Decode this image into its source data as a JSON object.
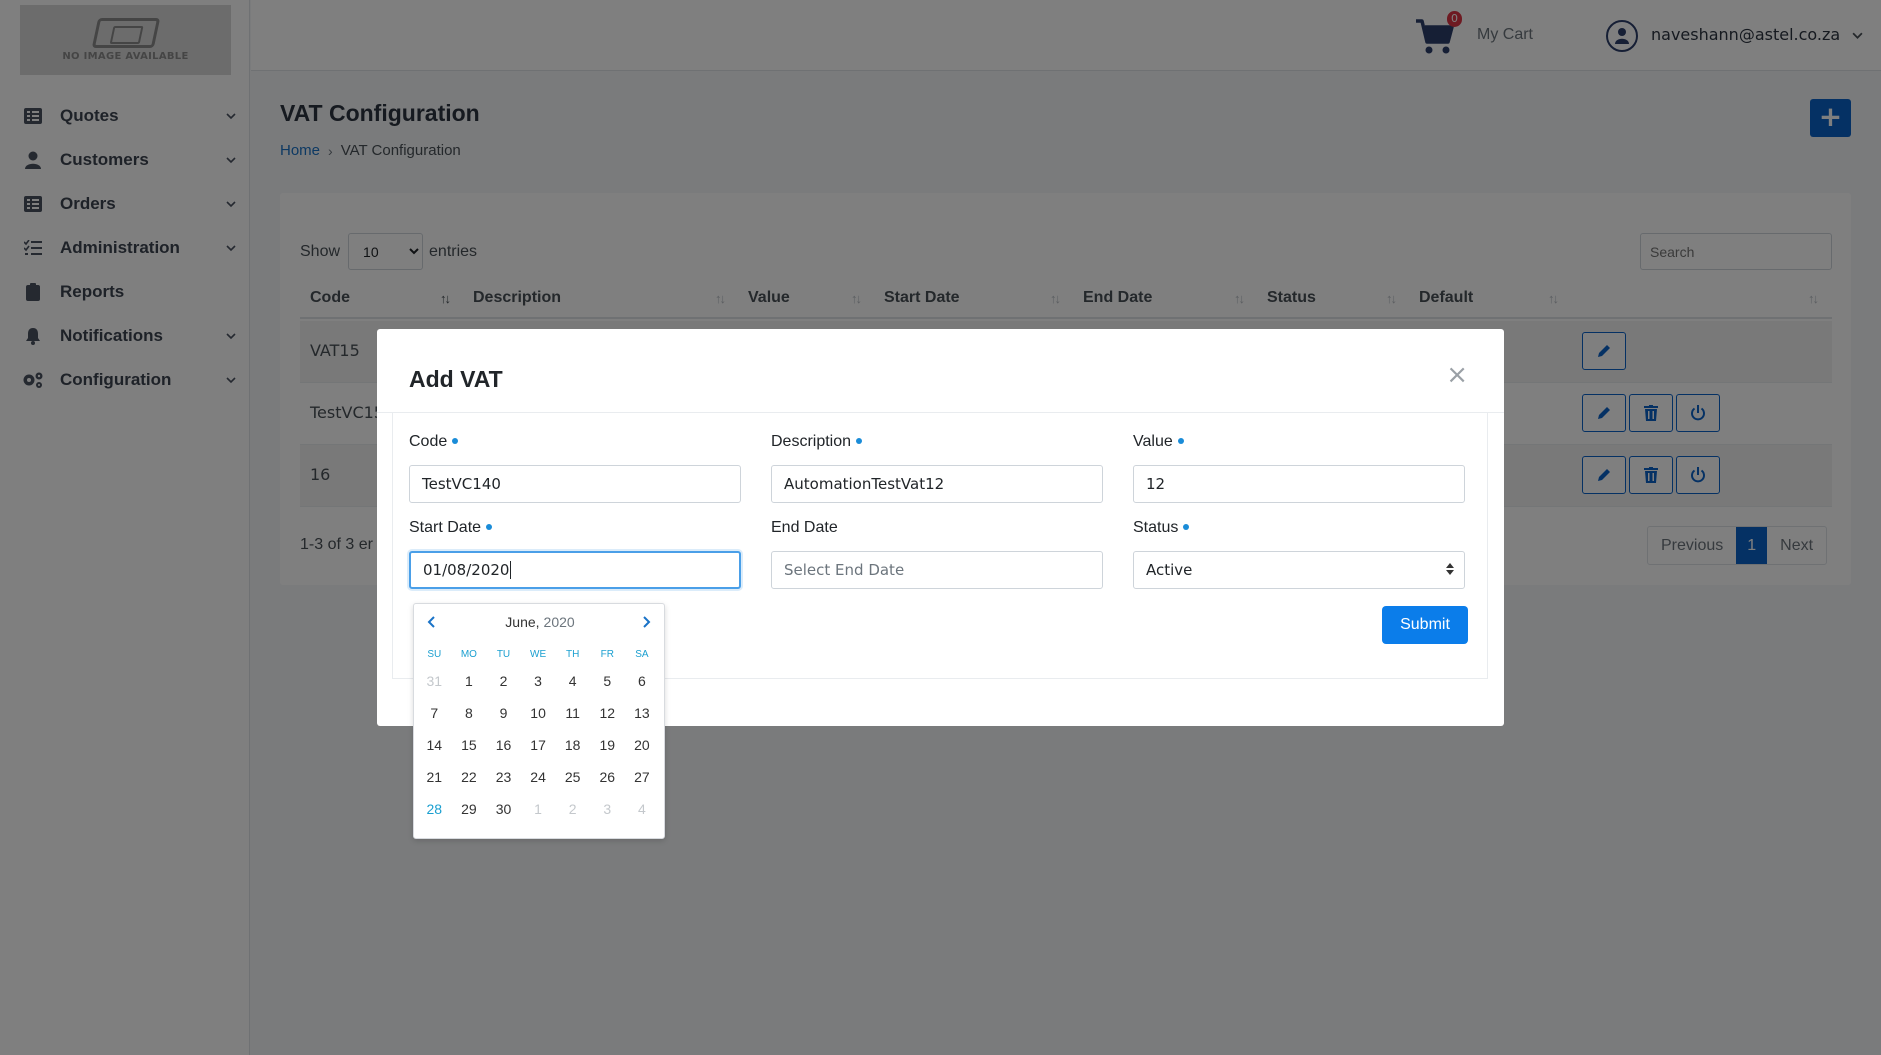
{
  "sidebar": {
    "logo_text": "NO IMAGE AVAILABLE",
    "items": [
      {
        "label": "Quotes",
        "icon": "list-icon",
        "has_chevron": true
      },
      {
        "label": "Customers",
        "icon": "user-icon",
        "has_chevron": true
      },
      {
        "label": "Orders",
        "icon": "list-icon",
        "has_chevron": true
      },
      {
        "label": "Administration",
        "icon": "tasks-icon",
        "has_chevron": true
      },
      {
        "label": "Reports",
        "icon": "clipboard-icon",
        "has_chevron": false
      },
      {
        "label": "Notifications",
        "icon": "bell-icon",
        "has_chevron": true
      },
      {
        "label": "Configuration",
        "icon": "cogs-icon",
        "has_chevron": true
      }
    ]
  },
  "topbar": {
    "cart_count": "0",
    "cart_label": "My Cart",
    "user_email": "naveshann@astel.co.za"
  },
  "page": {
    "title": "VAT Configuration",
    "breadcrumb_home": "Home",
    "breadcrumb_current": "VAT Configuration",
    "add_label": "+"
  },
  "table": {
    "show_label": "Show",
    "entries_label": "entries",
    "page_size": "10",
    "search_placeholder": "Search",
    "columns": [
      "Code",
      "Description",
      "Value",
      "Start Date",
      "End Date",
      "Status",
      "Default"
    ],
    "rows": [
      {
        "code": "VAT15"
      },
      {
        "code": "TestVC15"
      },
      {
        "code": "16"
      }
    ],
    "info": "1-3 of 3 er",
    "pager": {
      "previous": "Previous",
      "current": "1",
      "next": "Next"
    }
  },
  "modal": {
    "title": "Add VAT",
    "close": "×",
    "fields": {
      "code": {
        "label": "Code",
        "value": "TestVC140"
      },
      "description": {
        "label": "Description",
        "value": "AutomationTestVat12"
      },
      "value": {
        "label": "Value",
        "value": "12"
      },
      "start_date": {
        "label": "Start Date",
        "value": "01/08/2020"
      },
      "end_date": {
        "label": "End Date",
        "placeholder": "Select End Date"
      },
      "status": {
        "label": "Status",
        "value": "Active"
      }
    },
    "submit": "Submit"
  },
  "datepicker": {
    "month": "June,",
    "year": "2020",
    "weekdays": [
      "SU",
      "MO",
      "TU",
      "WE",
      "TH",
      "FR",
      "SA"
    ],
    "days": [
      {
        "d": "31",
        "muted": true
      },
      {
        "d": "1"
      },
      {
        "d": "2"
      },
      {
        "d": "3"
      },
      {
        "d": "4"
      },
      {
        "d": "5"
      },
      {
        "d": "6"
      },
      {
        "d": "7"
      },
      {
        "d": "8"
      },
      {
        "d": "9"
      },
      {
        "d": "10"
      },
      {
        "d": "11"
      },
      {
        "d": "12"
      },
      {
        "d": "13"
      },
      {
        "d": "14"
      },
      {
        "d": "15"
      },
      {
        "d": "16"
      },
      {
        "d": "17"
      },
      {
        "d": "18"
      },
      {
        "d": "19"
      },
      {
        "d": "20"
      },
      {
        "d": "21"
      },
      {
        "d": "22"
      },
      {
        "d": "23"
      },
      {
        "d": "24"
      },
      {
        "d": "25"
      },
      {
        "d": "26"
      },
      {
        "d": "27"
      },
      {
        "d": "28",
        "today": true
      },
      {
        "d": "29"
      },
      {
        "d": "30"
      },
      {
        "d": "1",
        "muted": true
      },
      {
        "d": "2",
        "muted": true
      },
      {
        "d": "3",
        "muted": true
      },
      {
        "d": "4",
        "muted": true
      }
    ]
  },
  "colors": {
    "primary": "#0b63c9",
    "submit": "#0b7dea",
    "badge": "#dc3545",
    "required_dot": "#1a8cd8",
    "overlay": "rgba(0,0,0,0.5)"
  }
}
